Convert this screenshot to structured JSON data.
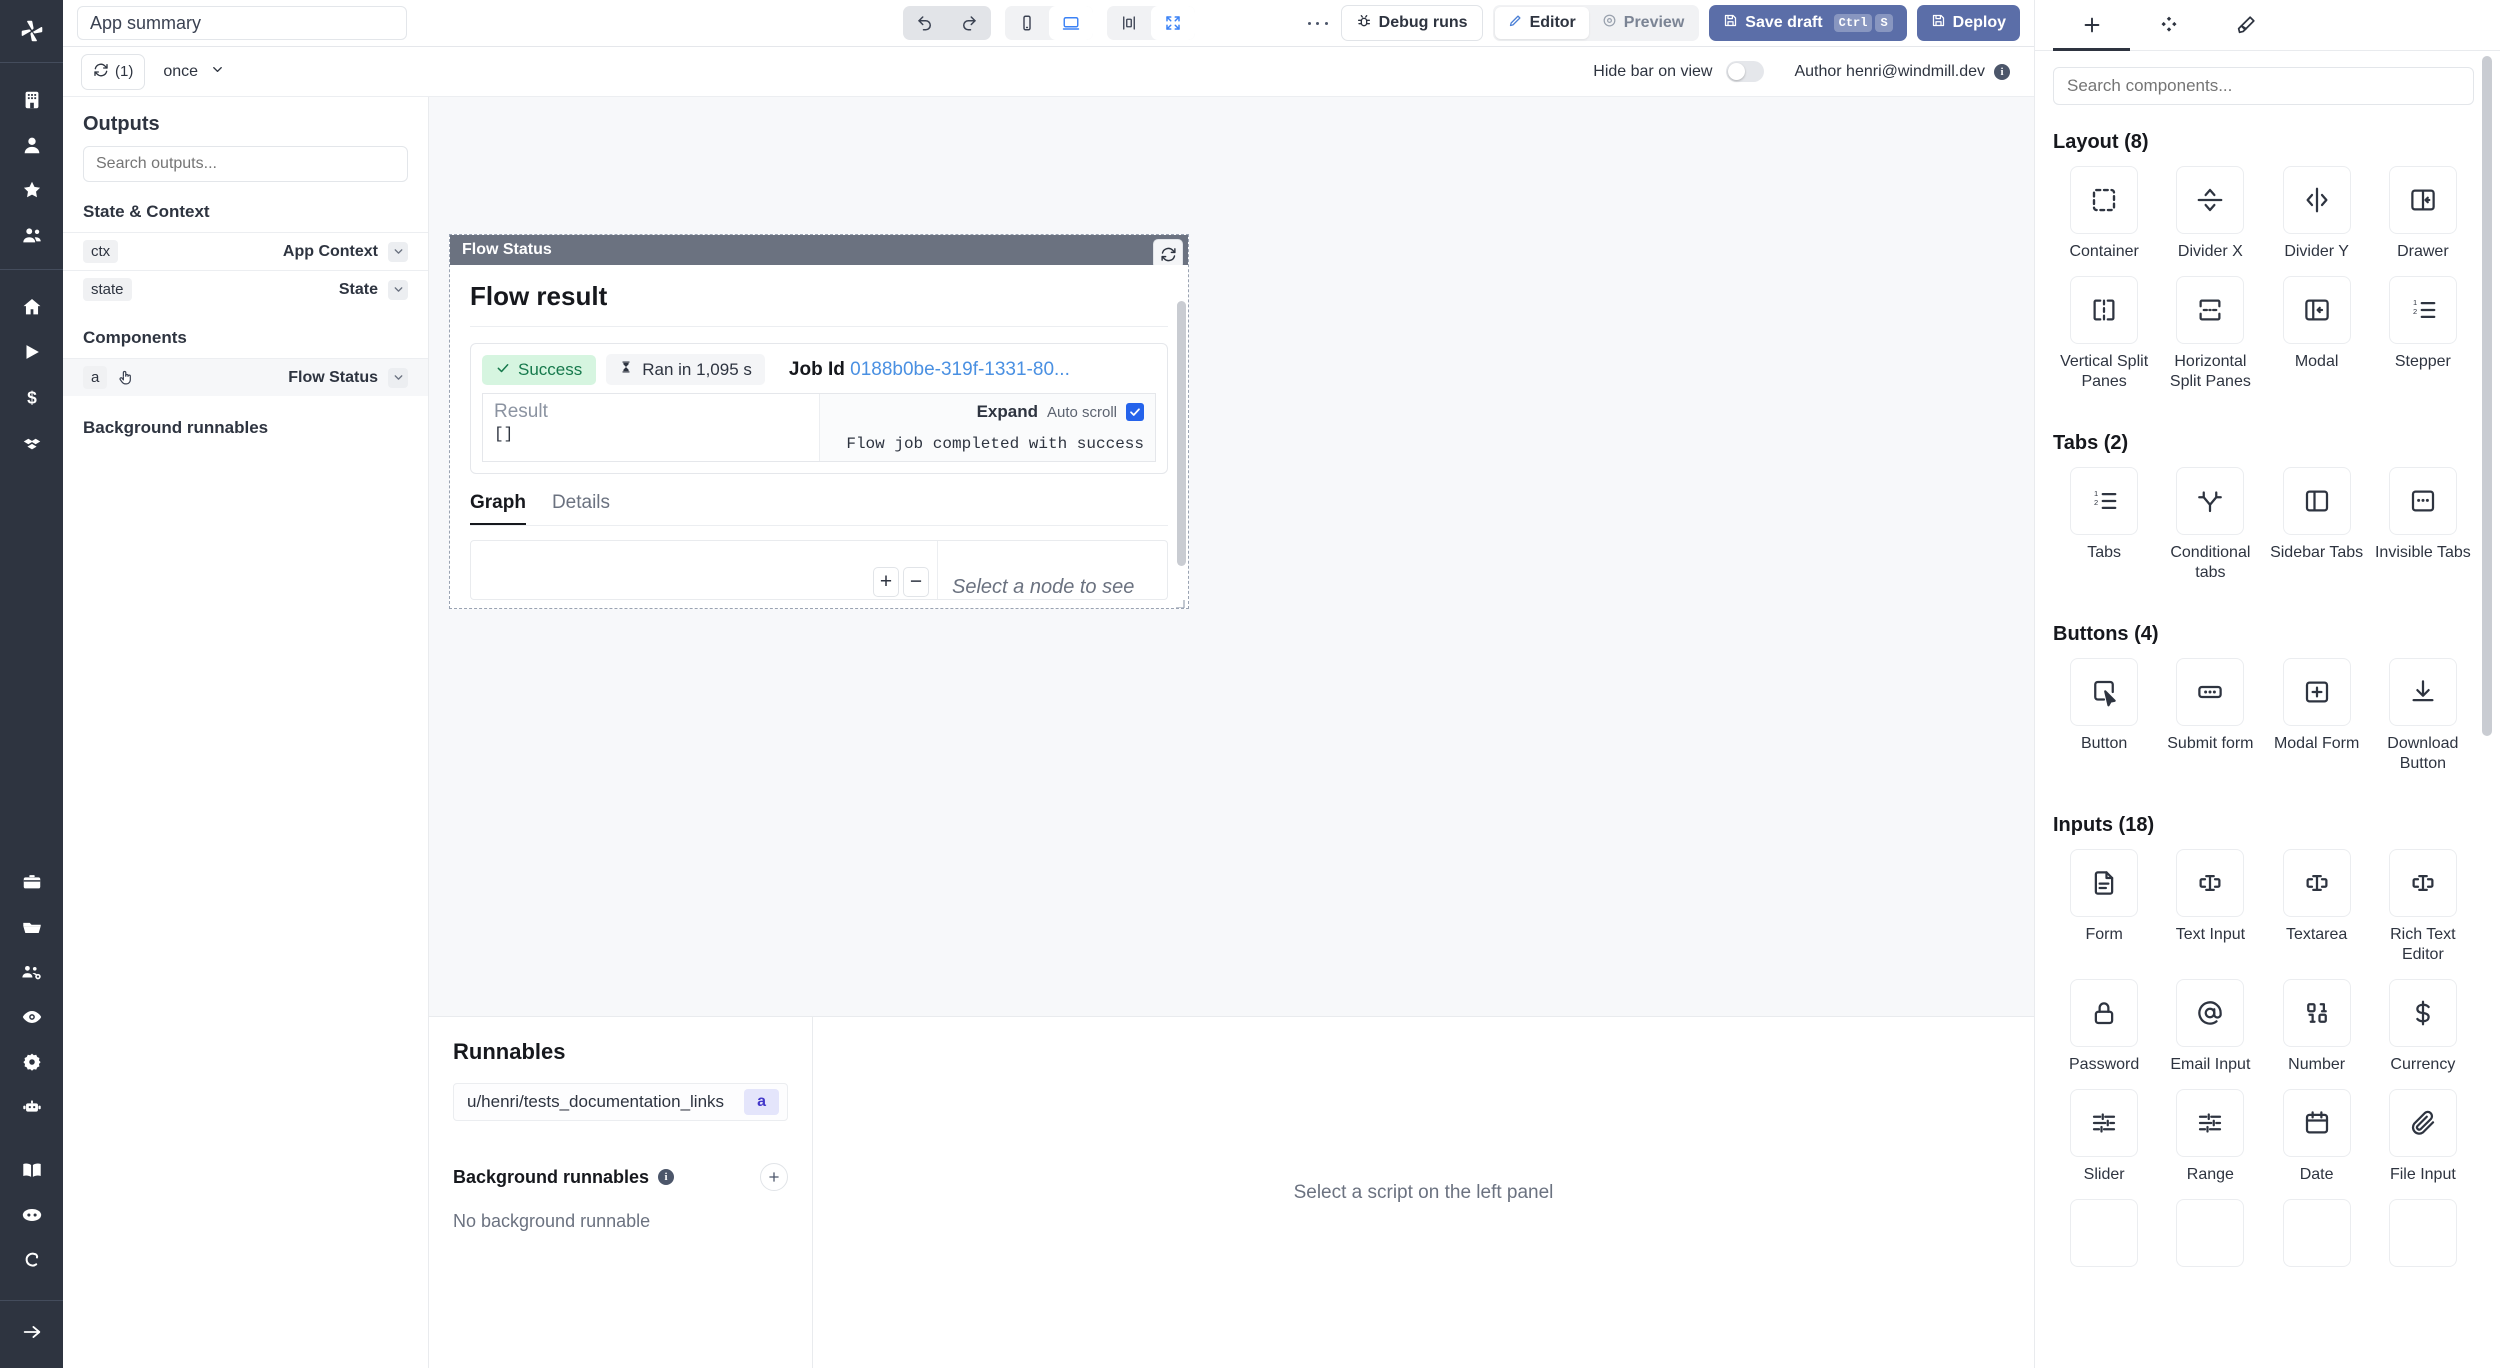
{
  "rail": {
    "logo": "windmill-logo-icon",
    "groups": [
      [
        "building-icon",
        "user-icon",
        "star-icon",
        "users-icon"
      ],
      [
        "home-icon",
        "play-icon",
        "dollar-icon",
        "blocks-icon"
      ],
      [
        "briefcase-icon",
        "folder-icon",
        "team-settings-icon",
        "eye-icon",
        "gear-icon",
        "robot-icon"
      ],
      [
        "book-icon",
        "discord-icon",
        "github-icon"
      ]
    ],
    "footer": "arrow-right-icon"
  },
  "topbar": {
    "app_name_value": "App summary",
    "app_name_placeholder": "App summary",
    "undo_icon": "undo-icon",
    "redo_icon": "redo-icon",
    "mobile_icon": "mobile-icon",
    "desktop_icon": "desktop-icon",
    "narrow_icon": "narrow-width-icon",
    "fullscreen_icon": "fullscreen-icon",
    "kebab_icon": "more-vertical-icon",
    "debug_runs_label": "Debug runs",
    "editor_label": "Editor",
    "preview_label": "Preview",
    "save_draft_label": "Save draft",
    "save_draft_keys": [
      "Ctrl",
      "S"
    ],
    "deploy_label": "Deploy"
  },
  "subbar": {
    "run_count": "(1)",
    "refresh_icon": "refresh-cw-icon",
    "frequency": "once",
    "hide_bar_label": "Hide bar on view",
    "hide_bar_on": false,
    "author_label": "Author henri@windmill.dev",
    "info_icon": "info-icon"
  },
  "outputs": {
    "title": "Outputs",
    "search_placeholder": "Search outputs...",
    "search_value": "",
    "state_context_title": "State & Context",
    "state_rows": [
      {
        "key": "ctx",
        "label": "App Context"
      },
      {
        "key": "state",
        "label": "State"
      }
    ],
    "components_title": "Components",
    "component_rows": [
      {
        "key": "a",
        "label": "Flow Status",
        "icon": "pointer-hand-icon"
      }
    ],
    "background_runnables_title": "Background runnables"
  },
  "flow_status": {
    "component_title": "Flow Status",
    "refresh_icon": "refresh-icon",
    "heading": "Flow result",
    "status_badge": "Success",
    "status_icon": "check-icon",
    "duration": "Ran in 1,095 s",
    "duration_icon": "hourglass-icon",
    "job_id_label": "Job Id",
    "job_id_value": "0188b0be-319f-1331-80...",
    "result_label": "Result",
    "result_value": "[]",
    "expand_label": "Expand",
    "auto_scroll_label": "Auto scroll",
    "auto_scroll_checked": true,
    "log_text": "Flow job completed with success",
    "tabs": [
      {
        "label": "Graph",
        "active": true
      },
      {
        "label": "Details",
        "active": false
      }
    ],
    "zoom_in": "+",
    "zoom_out": "−",
    "select_node_text": "Select a node to see"
  },
  "runnables": {
    "title": "Runnables",
    "items": [
      {
        "path": "u/henri/tests_documentation_links",
        "tag": "a"
      }
    ],
    "background_title": "Background runnables",
    "background_info_icon": "info-icon",
    "add_icon": "plus-icon",
    "empty_text": "No background runnable"
  },
  "script_panel": {
    "empty_text": "Select a script on the left panel"
  },
  "right_panel": {
    "tabs": [
      {
        "icon": "plus-icon",
        "name": "add-component-tab",
        "active": true
      },
      {
        "icon": "diamonds-icon",
        "name": "components-tree-tab",
        "active": false
      },
      {
        "icon": "brush-icon",
        "name": "styling-tab",
        "active": false
      }
    ],
    "search_placeholder": "Search components...",
    "search_value": "",
    "categories": [
      {
        "title": "Layout (8)",
        "items": [
          {
            "label": "Container",
            "icon": "dashed-square-icon"
          },
          {
            "label": "Divider X",
            "icon": "divider-x-icon"
          },
          {
            "label": "Divider Y",
            "icon": "divider-y-icon"
          },
          {
            "label": "Drawer",
            "icon": "drawer-icon"
          },
          {
            "label": "Vertical Split Panes",
            "icon": "vertical-split-icon"
          },
          {
            "label": "Horizontal Split Panes",
            "icon": "horizontal-split-icon"
          },
          {
            "label": "Modal",
            "icon": "modal-icon"
          },
          {
            "label": "Stepper",
            "icon": "ordered-list-icon"
          }
        ]
      },
      {
        "title": "Tabs (2)",
        "items": [
          {
            "label": "Tabs",
            "icon": "ordered-list-icon"
          },
          {
            "label": "Conditional tabs",
            "icon": "branch-icon"
          },
          {
            "label": "Sidebar Tabs",
            "icon": "sidebar-panel-icon"
          },
          {
            "label": "Invisible Tabs",
            "icon": "dots-box-icon"
          }
        ]
      },
      {
        "title": "Buttons (4)",
        "items": [
          {
            "label": "Button",
            "icon": "cursor-click-icon"
          },
          {
            "label": "Submit form",
            "icon": "dots-box-icon"
          },
          {
            "label": "Modal Form",
            "icon": "plus-box-icon"
          },
          {
            "label": "Download Button",
            "icon": "download-icon"
          }
        ]
      },
      {
        "title": "Inputs (18)",
        "items": [
          {
            "label": "Form",
            "icon": "document-icon"
          },
          {
            "label": "Text Input",
            "icon": "text-cursor-icon"
          },
          {
            "label": "Textarea",
            "icon": "text-cursor-icon"
          },
          {
            "label": "Rich Text Editor",
            "icon": "text-cursor-icon"
          },
          {
            "label": "Password",
            "icon": "lock-icon"
          },
          {
            "label": "Email Input",
            "icon": "at-sign-icon"
          },
          {
            "label": "Number",
            "icon": "binary-icon"
          },
          {
            "label": "Currency",
            "icon": "dollar-icon"
          },
          {
            "label": "Slider",
            "icon": "sliders-icon"
          },
          {
            "label": "Range",
            "icon": "sliders-icon"
          },
          {
            "label": "Date",
            "icon": "calendar-icon"
          },
          {
            "label": "File Input",
            "icon": "paperclip-icon"
          }
        ]
      }
    ]
  },
  "colors": {
    "rail_bg": "#2e3440",
    "primary": "#5b6ea8",
    "accent_blue": "#2563eb",
    "success_bg": "#d6f5e0",
    "success_fg": "#16794c",
    "link": "#4a90e2",
    "comp_header": "#6b7280",
    "canvas_bg": "#f7f8fa"
  }
}
